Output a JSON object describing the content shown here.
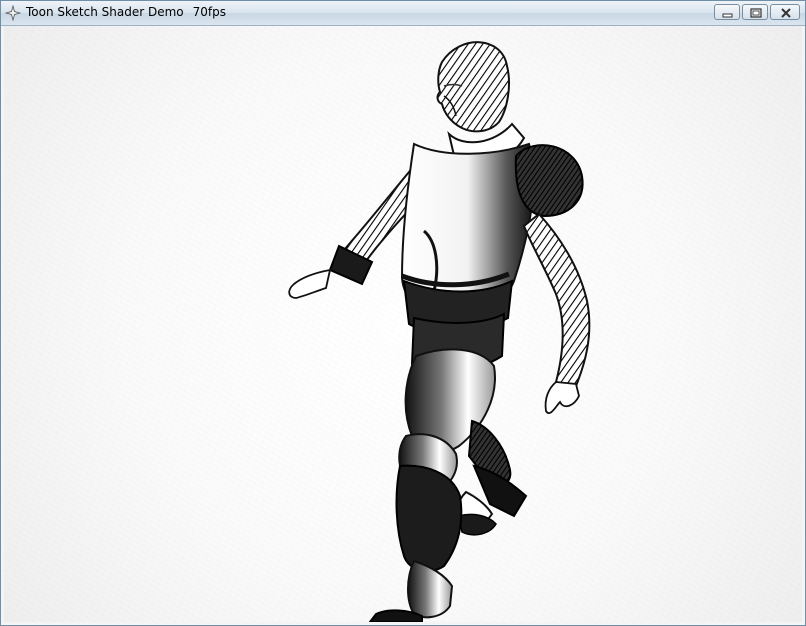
{
  "window": {
    "title": "Toon Sketch Shader Demo",
    "fps": "70fps",
    "icons": [
      "app-icon",
      "minimize-icon",
      "maximize-icon",
      "close-icon"
    ]
  },
  "scene": {
    "subject": "walking-figure-sketch-render",
    "style": "pencil-hatching",
    "colors": {
      "ink": "#111111",
      "paper": "#ffffff",
      "frame": "#6f8fa8"
    }
  }
}
